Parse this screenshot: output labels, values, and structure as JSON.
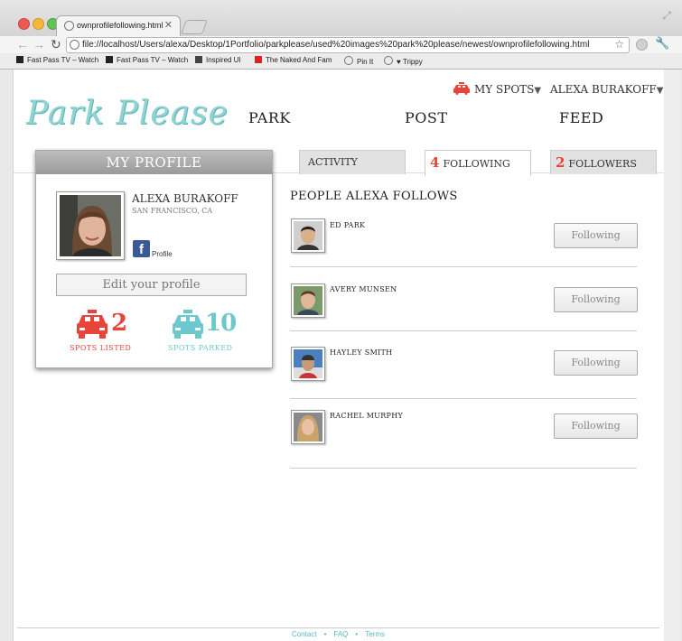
{
  "browser": {
    "tab_title": "ownprofilefollowing.html",
    "tab_close": "✕",
    "url": "file://localhost/Users/alexa/Desktop/1Portfolio/parkplease/used%20images%20park%20please/newest/ownprofilefollowing.html",
    "bookmarks": [
      "Fast Pass TV – Watch",
      "Fast Pass TV – Watch",
      "Inspired UI",
      "The Naked And Fam",
      "Pin It",
      "♥ Trippy"
    ]
  },
  "site": {
    "logo": "Park Please",
    "nav": [
      "PARK",
      "POST",
      "FEED"
    ],
    "my_spots": "MY SPOTS",
    "user_menu": "ALEXA BURAKOFF"
  },
  "profile": {
    "header": "MY PROFILE",
    "name": "ALEXA BURAKOFF",
    "location": "SAN FRANCISCO, CA",
    "facebook_label": "Profile",
    "edit_button": "Edit your profile",
    "spots_listed": "2",
    "spots_listed_label": "SPOTS LISTED",
    "spots_parked": "10",
    "spots_parked_label": "SPOTS PARKED"
  },
  "tabs": {
    "activity": "ACTIVITY",
    "following_count": "4",
    "following": "FOLLOWING",
    "followers_count": "2",
    "followers": "FOLLOWERS"
  },
  "following": {
    "title": "PEOPLE ALEXA FOLLOWS",
    "people": [
      {
        "name": "ED PARK",
        "button": "Following"
      },
      {
        "name": "AVERY MUNSEN",
        "button": "Following"
      },
      {
        "name": "HAYLEY SMITH",
        "button": "Following"
      },
      {
        "name": "RACHEL MURPHY",
        "button": "Following"
      }
    ]
  },
  "footer": {
    "links": [
      "Contact",
      "FAQ",
      "Terms"
    ],
    "separator": "•"
  },
  "colors": {
    "accent_red": "#e8443a",
    "accent_teal": "#6cc8cc",
    "logo": "#8fd3d3"
  }
}
